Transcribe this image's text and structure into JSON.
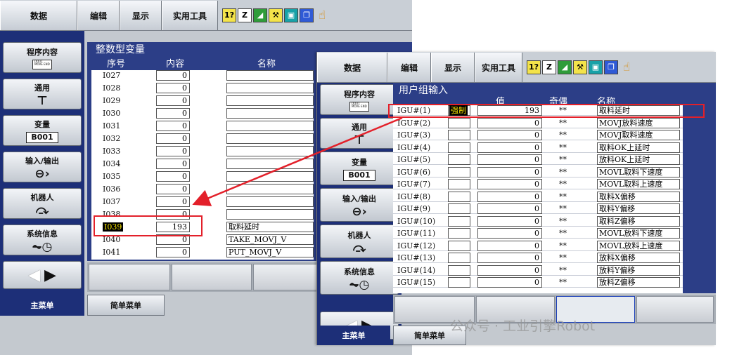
{
  "menu": {
    "data": "数据",
    "edit": "编辑",
    "display": "显示",
    "utility": "实用工具"
  },
  "menu_icons": [
    "1? status-icon",
    "edit-icon",
    "chart-icon",
    "tool-icon",
    "monitor-icon",
    "window-icon",
    "hand-icon"
  ],
  "menu_icon_glyphs": {
    "status": "1?",
    "edit": "Z",
    "chart": "◢",
    "tool": "⚒",
    "monitor": "▣",
    "window": "❐",
    "hand": "☝"
  },
  "side": {
    "program_content": "程序内容",
    "doc_icon_text": "DOUT MOVE END",
    "general": "通用",
    "variable": "变量",
    "variable_box": "B001",
    "io": "输入/输出",
    "io_in": "In",
    "io_out": "Out",
    "robot": "机器人",
    "system_info": "系统信息"
  },
  "bottom": {
    "main_menu": "主菜单",
    "simple_menu": "简单菜单"
  },
  "left_screen": {
    "title": "整数型变量",
    "col_index": "序号",
    "col_content": "内容",
    "col_name": "名称",
    "rows": [
      {
        "index": "I027",
        "value": "0",
        "name": ""
      },
      {
        "index": "I028",
        "value": "0",
        "name": ""
      },
      {
        "index": "I029",
        "value": "0",
        "name": ""
      },
      {
        "index": "I030",
        "value": "0",
        "name": ""
      },
      {
        "index": "I031",
        "value": "0",
        "name": ""
      },
      {
        "index": "I032",
        "value": "0",
        "name": ""
      },
      {
        "index": "I033",
        "value": "0",
        "name": ""
      },
      {
        "index": "I034",
        "value": "0",
        "name": ""
      },
      {
        "index": "I035",
        "value": "0",
        "name": ""
      },
      {
        "index": "I036",
        "value": "0",
        "name": ""
      },
      {
        "index": "I037",
        "value": "0",
        "name": ""
      },
      {
        "index": "I038",
        "value": "0",
        "name": ""
      },
      {
        "index": "I039",
        "value": "193",
        "name": "取料延时"
      },
      {
        "index": "I040",
        "value": "0",
        "name": "TAKE_MOVJ_V"
      },
      {
        "index": "I041",
        "value": "0",
        "name": "PUT_MOVJ_V"
      }
    ]
  },
  "right_screen": {
    "title": "用户组输入",
    "col_value": "值",
    "col_parity": "奇偶",
    "col_name": "名称",
    "force_label": "强制",
    "rows": [
      {
        "index": "IGU#(1)",
        "value": "193",
        "parity": "**",
        "name": "取料延时"
      },
      {
        "index": "IGU#(2)",
        "value": "0",
        "parity": "**",
        "name": "MOVJ放料速度"
      },
      {
        "index": "IGU#(3)",
        "value": "0",
        "parity": "**",
        "name": "MOVJ取料速度"
      },
      {
        "index": "IGU#(4)",
        "value": "0",
        "parity": "**",
        "name": "取料OK上延时"
      },
      {
        "index": "IGU#(5)",
        "value": "0",
        "parity": "**",
        "name": "放料OK上延时"
      },
      {
        "index": "IGU#(6)",
        "value": "0",
        "parity": "**",
        "name": "MOVL取料下速度"
      },
      {
        "index": "IGU#(7)",
        "value": "0",
        "parity": "**",
        "name": "MOVL取料上速度"
      },
      {
        "index": "IGU#(8)",
        "value": "0",
        "parity": "**",
        "name": "取料X偏移"
      },
      {
        "index": "IGU#(9)",
        "value": "0",
        "parity": "**",
        "name": "取料Y偏移"
      },
      {
        "index": "IGU#(10)",
        "value": "0",
        "parity": "**",
        "name": "取料Z偏移"
      },
      {
        "index": "IGU#(11)",
        "value": "0",
        "parity": "**",
        "name": "MOVL放料下速度"
      },
      {
        "index": "IGU#(12)",
        "value": "0",
        "parity": "**",
        "name": "MOVL放料上速度"
      },
      {
        "index": "IGU#(13)",
        "value": "0",
        "parity": "**",
        "name": "放料X偏移"
      },
      {
        "index": "IGU#(14)",
        "value": "0",
        "parity": "**",
        "name": "放料Y偏移"
      },
      {
        "index": "IGU#(15)",
        "value": "0",
        "parity": "**",
        "name": "放料Z偏移"
      }
    ]
  },
  "watermark": "公众号 · 工业引擎Robot",
  "colors": {
    "screen_blue": "#2c3e87",
    "side_blue": "#1d2f78",
    "highlight_red": "#e3202a",
    "selection_yellow": "#f5e200"
  }
}
